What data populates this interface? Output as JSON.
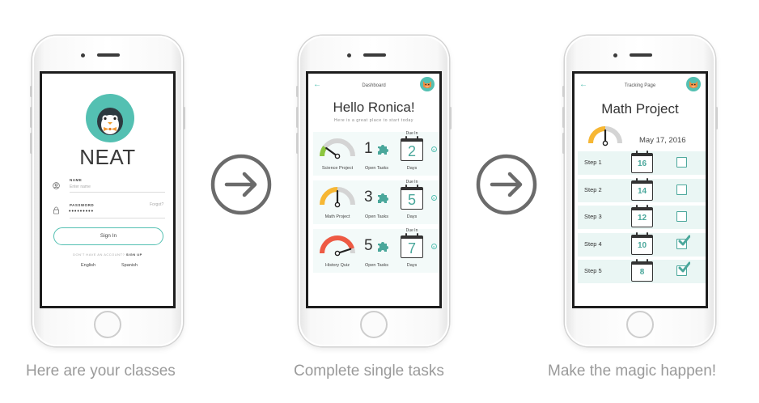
{
  "screens": {
    "login": {
      "app_name": "NEAT",
      "name_label": "NAME",
      "name_placeholder": "Enter name",
      "password_label": "PASSWORD",
      "password_value": "•••••••••",
      "forgot_label": "Forgot?",
      "sign_in_label": "Sign In",
      "no_account_text": "DON'T HAVE AN ACCOUNT?",
      "sign_up_label": "SIGN UP",
      "languages": [
        "English",
        "Spanish"
      ],
      "icons": [
        "penguin-avatar",
        "user-icon",
        "lock-icon"
      ]
    },
    "dashboard": {
      "title": "Dashboard",
      "greeting": "Hello Ronica!",
      "subtitle": "Here is a great place to start today",
      "open_tasks_label": "Open Tasks",
      "due_in_label": "Due In",
      "days_label": "Days",
      "classes": [
        {
          "name": "Science Project",
          "open_tasks": "1",
          "due_days": "2",
          "gauge_level": 0.2,
          "gauge_color": "#8cc63f"
        },
        {
          "name": "Math Project",
          "open_tasks": "3",
          "due_days": "5",
          "gauge_level": 0.5,
          "gauge_color": "#f7b733"
        },
        {
          "name": "History Quiz",
          "open_tasks": "5",
          "due_days": "7",
          "gauge_level": 0.9,
          "gauge_color": "#ee5a44"
        }
      ]
    },
    "tracking": {
      "title": "Tracking Page",
      "project": "Math Project",
      "date": "May 17, 2016",
      "gauge_level": 0.5,
      "steps": [
        {
          "label": "Step 1",
          "day": "16",
          "done": false
        },
        {
          "label": "Step 2",
          "day": "14",
          "done": false
        },
        {
          "label": "Step 3",
          "day": "12",
          "done": false
        },
        {
          "label": "Step 4",
          "day": "10",
          "done": true
        },
        {
          "label": "Step 5",
          "day": "8",
          "done": true
        }
      ]
    }
  },
  "captions": [
    "Here are your classes",
    "Complete single tasks",
    "Make the magic happen!"
  ],
  "colors": {
    "accent": "#54c0b2",
    "check": "#4aa79b",
    "arrow": "#6b6b6b",
    "caption": "#9a9a9a"
  }
}
